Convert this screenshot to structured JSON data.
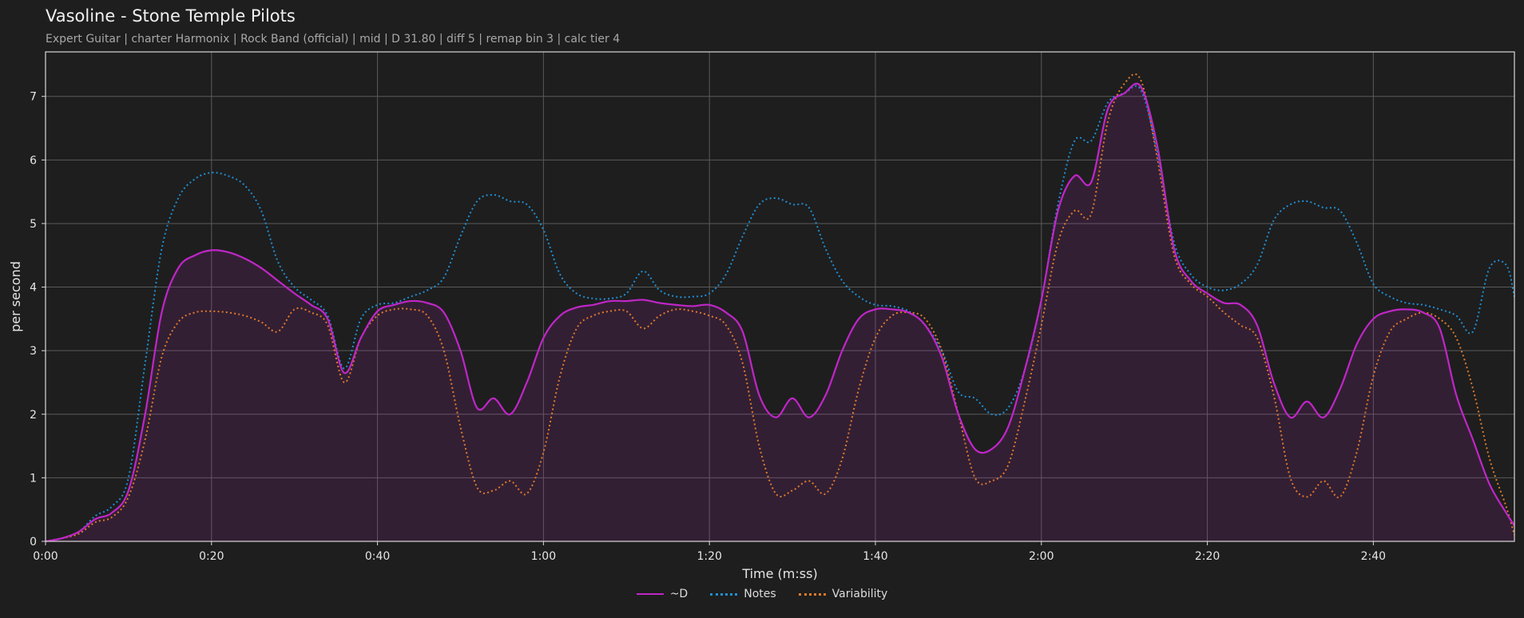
{
  "title": "Vasoline - Stone Temple Pilots",
  "subtitle": "Expert Guitar  |  charter Harmonix  |  Rock Band (official)  |  mid  |  D 31.80  |  diff 5  |  remap bin 3  |  calc tier 4",
  "chart_data": {
    "type": "line",
    "xlabel": "Time (m:ss)",
    "ylabel": "per second",
    "xlim": [
      0,
      177
    ],
    "ylim": [
      0,
      7.7
    ],
    "x_ticks": [
      0,
      20,
      40,
      60,
      80,
      100,
      120,
      140,
      160
    ],
    "x_tick_labels": [
      "0:00",
      "0:20",
      "0:40",
      "1:00",
      "1:20",
      "1:40",
      "2:00",
      "2:20",
      "2:40"
    ],
    "y_ticks": [
      0,
      1,
      2,
      3,
      4,
      5,
      6,
      7
    ],
    "grid": true,
    "legend_position": "bottom-center",
    "x": [
      0,
      2,
      4,
      6,
      8,
      10,
      12,
      14,
      16,
      18,
      20,
      22,
      24,
      26,
      28,
      30,
      32,
      34,
      36,
      38,
      40,
      42,
      44,
      46,
      48,
      50,
      52,
      54,
      56,
      58,
      60,
      62,
      64,
      66,
      68,
      70,
      72,
      74,
      76,
      78,
      80,
      82,
      84,
      86,
      88,
      90,
      92,
      94,
      96,
      98,
      100,
      102,
      104,
      106,
      108,
      110,
      112,
      114,
      116,
      118,
      120,
      122,
      124,
      126,
      128,
      130,
      132,
      134,
      136,
      138,
      140,
      142,
      144,
      146,
      148,
      150,
      152,
      154,
      156,
      158,
      160,
      162,
      164,
      166,
      168,
      170,
      172,
      174,
      176,
      177
    ],
    "series": [
      {
        "name": "~D",
        "color": "#c026c8",
        "style": "solid",
        "fill": true,
        "values": [
          0.0,
          0.05,
          0.15,
          0.35,
          0.45,
          0.8,
          2.0,
          3.6,
          4.3,
          4.5,
          4.58,
          4.55,
          4.45,
          4.3,
          4.1,
          3.9,
          3.72,
          3.5,
          2.65,
          3.2,
          3.62,
          3.72,
          3.78,
          3.75,
          3.6,
          3.0,
          2.1,
          2.25,
          2.0,
          2.5,
          3.2,
          3.55,
          3.68,
          3.72,
          3.78,
          3.78,
          3.8,
          3.75,
          3.72,
          3.7,
          3.72,
          3.6,
          3.3,
          2.3,
          1.95,
          2.25,
          1.95,
          2.3,
          3.0,
          3.5,
          3.65,
          3.65,
          3.6,
          3.4,
          2.9,
          2.0,
          1.45,
          1.45,
          1.8,
          2.7,
          3.8,
          5.2,
          5.75,
          5.65,
          6.8,
          7.05,
          7.15,
          6.2,
          4.6,
          4.1,
          3.9,
          3.75,
          3.72,
          3.4,
          2.5,
          1.95,
          2.2,
          1.95,
          2.4,
          3.1,
          3.5,
          3.62,
          3.65,
          3.6,
          3.35,
          2.3,
          1.6,
          0.9,
          0.45,
          0.25
        ]
      },
      {
        "name": "Notes",
        "color": "#1f8fd6",
        "style": "dotted",
        "fill": false,
        "values": [
          0.0,
          0.05,
          0.15,
          0.4,
          0.55,
          1.0,
          2.8,
          4.6,
          5.4,
          5.7,
          5.8,
          5.75,
          5.6,
          5.2,
          4.4,
          4.0,
          3.8,
          3.55,
          2.72,
          3.5,
          3.72,
          3.75,
          3.85,
          3.95,
          4.15,
          4.8,
          5.35,
          5.45,
          5.35,
          5.3,
          4.9,
          4.2,
          3.9,
          3.82,
          3.82,
          3.9,
          4.25,
          3.95,
          3.85,
          3.85,
          3.9,
          4.2,
          4.8,
          5.3,
          5.4,
          5.3,
          5.25,
          4.6,
          4.1,
          3.85,
          3.72,
          3.7,
          3.62,
          3.4,
          3.0,
          2.35,
          2.25,
          2.0,
          2.1,
          2.7,
          3.8,
          5.3,
          6.3,
          6.3,
          6.9,
          7.05,
          7.1,
          6.1,
          4.7,
          4.2,
          4.0,
          3.95,
          4.05,
          4.35,
          5.05,
          5.3,
          5.35,
          5.25,
          5.2,
          4.7,
          4.05,
          3.85,
          3.75,
          3.72,
          3.65,
          3.55,
          3.3,
          4.3,
          4.35,
          3.85
        ]
      },
      {
        "name": "Variability",
        "color": "#e07a2a",
        "style": "dotted",
        "fill": false,
        "values": [
          0.0,
          0.05,
          0.12,
          0.3,
          0.38,
          0.7,
          1.6,
          2.9,
          3.45,
          3.6,
          3.62,
          3.6,
          3.55,
          3.45,
          3.3,
          3.65,
          3.6,
          3.4,
          2.5,
          3.2,
          3.55,
          3.65,
          3.65,
          3.55,
          3.0,
          1.8,
          0.85,
          0.8,
          0.95,
          0.75,
          1.4,
          2.6,
          3.35,
          3.55,
          3.62,
          3.62,
          3.35,
          3.55,
          3.65,
          3.62,
          3.55,
          3.4,
          2.8,
          1.5,
          0.75,
          0.8,
          0.95,
          0.75,
          1.3,
          2.4,
          3.2,
          3.55,
          3.6,
          3.5,
          3.0,
          2.0,
          1.0,
          0.95,
          1.2,
          2.2,
          3.4,
          4.7,
          5.2,
          5.15,
          6.6,
          7.2,
          7.25,
          6.0,
          4.5,
          4.05,
          3.85,
          3.6,
          3.4,
          3.2,
          2.3,
          1.0,
          0.7,
          0.95,
          0.7,
          1.4,
          2.6,
          3.3,
          3.5,
          3.6,
          3.5,
          3.2,
          2.4,
          1.3,
          0.55,
          0.1
        ]
      }
    ]
  }
}
